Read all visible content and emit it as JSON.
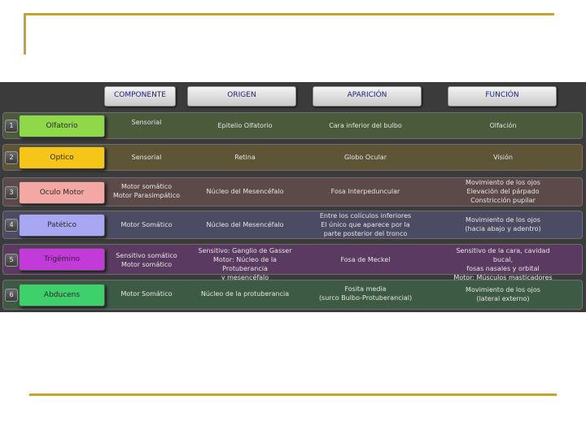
{
  "headers": {
    "componente": "COMPONENTE",
    "origen": "ORIGEN",
    "aparicion": "APARICIÓN",
    "funcion": "FUNCIÓN"
  },
  "rows": [
    {
      "number": "1",
      "nerve": "Olfatorio",
      "componente": "Sensorial",
      "origen": "Epitelio Olfatorio",
      "aparicion": "Cara inferior del bulbo",
      "funcion": "Olfación",
      "nerve_color": "#8fd84a",
      "row_color": "#4a5a3a"
    },
    {
      "number": "2",
      "nerve": "Optico",
      "componente": "Sensorial",
      "origen": "Retina",
      "aparicion": "Globo Ocular",
      "funcion": "Visión",
      "nerve_color": "#f5c617",
      "row_color": "#5d5536"
    },
    {
      "number": "3",
      "nerve": "Oculo Motor",
      "componente": "Motor somático\nMotor Parasimpático",
      "origen": "Núcleo del Mesencéfalo",
      "aparicion": "Fosa Interpeduncular",
      "funcion": "Movimiento de los ojos\nElevación del párpado\nConstricción pupilar",
      "nerve_color": "#f4a8a4",
      "row_color": "#5c4a4a"
    },
    {
      "number": "4",
      "nerve": "Patético",
      "componente": "Motor Somático",
      "origen": "Núcleo del Mesencéfalo",
      "aparicion": "Entre los colículos inferiores\nEl único que aparece por la\nparte posterior del tronco",
      "funcion": "Movimiento de los ojos\n(hacia abajo y adentro)",
      "nerve_color": "#a9a7f2",
      "row_color": "#4b4b63"
    },
    {
      "number": "5",
      "nerve": "Trigémino",
      "componente": "Sensitivo somático\nMotor somático",
      "origen": "Sensitivo: Ganglio de Gasser\nMotor: Núcleo de la Protuberancia\ny mesencéfalo",
      "aparicion": "Fosa de Meckel",
      "funcion": "Sensitivo de la cara, cavidad bucal,\nfosas nasales y orbital\nMotor: Músculos masticadores",
      "nerve_color": "#c23ad8",
      "row_color": "#5a3a60"
    },
    {
      "number": "6",
      "nerve": "Abducens",
      "componente": "Motor Somático",
      "origen": "Núcleo de la protuberancia",
      "aparicion": "Fosita media\n(surco Bulbo-Protuberancial)",
      "funcion": "Movimiento de los ojos\n(lateral externo)",
      "nerve_color": "#3ed06a",
      "row_color": "#3c5a44"
    }
  ]
}
